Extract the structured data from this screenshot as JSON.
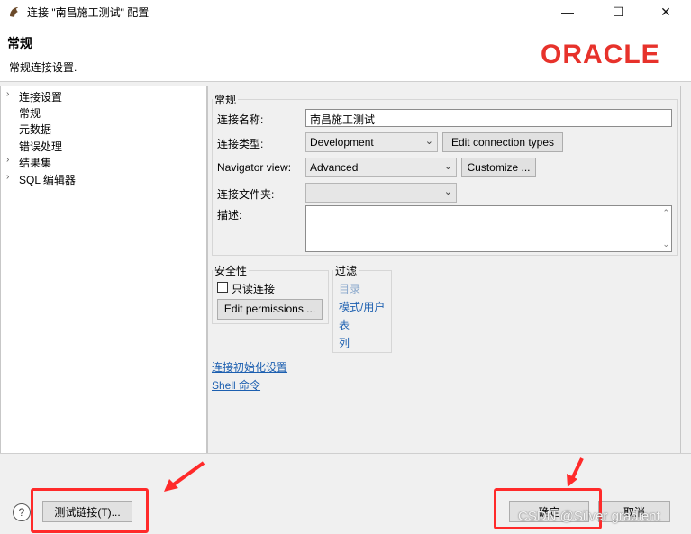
{
  "window": {
    "title": "连接 \"南昌施工测试\" 配置",
    "minimize_glyph": "—",
    "maximize_glyph": "☐",
    "close_glyph": "✕"
  },
  "header": {
    "title": "常规",
    "subtitle": "常规连接设置.",
    "logo_text": "ORACLE",
    "logo_color": "#e7322b"
  },
  "tree": {
    "items": [
      {
        "label": "连接设置",
        "expandable": true
      },
      {
        "label": "常规",
        "expandable": false,
        "selected": true
      },
      {
        "label": "元数据",
        "expandable": false
      },
      {
        "label": "错误处理",
        "expandable": false
      },
      {
        "label": "结果集",
        "expandable": true
      },
      {
        "label": "SQL 编辑器",
        "expandable": true
      }
    ]
  },
  "general": {
    "group_title": "常规",
    "name_label": "连接名称:",
    "name_value": "南昌施工测试",
    "type_label": "连接类型:",
    "type_value": "Development",
    "edit_types_button": "Edit connection types",
    "navigator_label": "Navigator view:",
    "navigator_value": "Advanced",
    "customize_button": "Customize ...",
    "folder_label": "连接文件夹:",
    "folder_value": "",
    "description_label": "描述:",
    "description_value": ""
  },
  "security": {
    "group_title": "安全性",
    "readonly_label": "只读连接",
    "readonly_checked": false,
    "edit_permissions_button": "Edit permissions ..."
  },
  "filter": {
    "group_title": "过滤",
    "links": [
      {
        "label": "目录",
        "enabled": false
      },
      {
        "label": "模式/用户",
        "enabled": true
      },
      {
        "label": "表",
        "enabled": true
      },
      {
        "label": "列",
        "enabled": true
      }
    ]
  },
  "links": {
    "init_settings": "连接初始化设置",
    "shell_commands": "Shell 命令"
  },
  "footer": {
    "help_glyph": "?",
    "test_button": "测试链接(T)...",
    "ok_button": "确定",
    "cancel_button": "取消",
    "watermark": "CSDN @Silver gradient",
    "highlight_color": "#ff2a2a"
  }
}
